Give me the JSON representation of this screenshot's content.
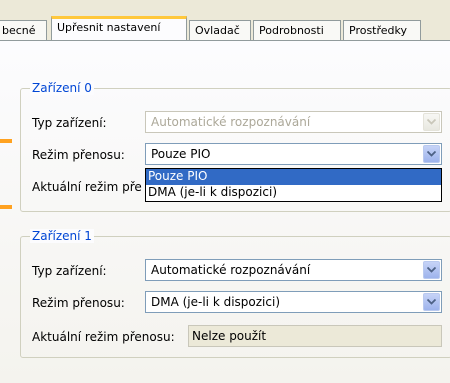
{
  "tabs": [
    {
      "label": "becné"
    },
    {
      "label": "Upřesnit nastavení"
    },
    {
      "label": "Ovladač"
    },
    {
      "label": "Podrobnosti"
    },
    {
      "label": "Prostředky"
    }
  ],
  "device0": {
    "title": "Zařízení 0",
    "device_type_label": "Typ zařízení:",
    "device_type_value": "Automatické rozpoznávání",
    "transfer_mode_label": "Režim přenosu:",
    "transfer_mode_value": "Pouze PIO",
    "current_mode_label": "Aktuální režim pře",
    "dropdown_options": [
      "Pouze PIO",
      "DMA (je-li k dispozici)"
    ]
  },
  "device1": {
    "title": "Zařízení 1",
    "device_type_label": "Typ zařízení:",
    "device_type_value": "Automatické rozpoznávání",
    "transfer_mode_label": "Režim přenosu:",
    "transfer_mode_value": "DMA (je-li k dispozici)",
    "current_mode_label": "Aktuální režim přenosu:",
    "current_mode_value": "Nelze použít"
  },
  "colors": {
    "group_title": "#0046d5",
    "selection": "#316ac5",
    "tab_highlight": "#ffc83c"
  }
}
